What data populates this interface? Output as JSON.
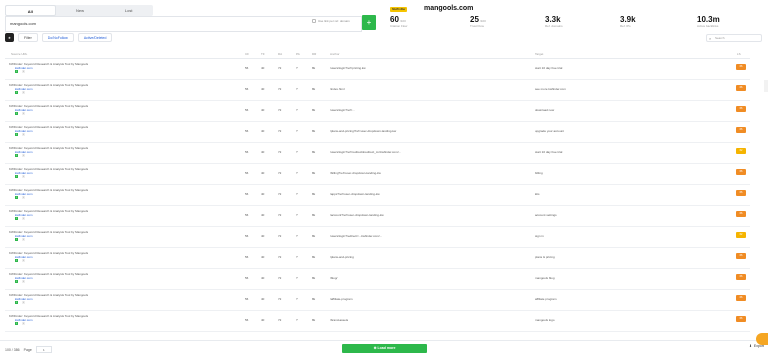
{
  "tabs": [
    "All",
    "New",
    "Lost"
  ],
  "search": {
    "value": "mangools.com",
    "include_label": "Use link per ref. domain"
  },
  "brand": {
    "badge": "SiteProfiler",
    "domain": "mangools.com"
  },
  "stats": [
    {
      "num": "60",
      "suffix": "/100",
      "label": "Citation Flow"
    },
    {
      "num": "25",
      "suffix": "/100",
      "label": "Trust Flow"
    },
    {
      "num": "3.3k",
      "suffix": "",
      "label": "Ref. domains"
    },
    {
      "num": "3.9k",
      "suffix": "",
      "label": "Ref. IPs"
    },
    {
      "num": "10.3m",
      "suffix": "",
      "label": "Active backlinks"
    }
  ],
  "toolbar": {
    "filter_label": "Filter",
    "dofollow_label": "Do/NoFollow",
    "active_label": "Active/Deleted",
    "search_placeholder": "Search"
  },
  "columns": [
    "Source URL",
    "CF",
    "TF",
    "DA",
    "PA",
    "DR",
    "Anchor",
    "Target",
    "Anchor",
    "LS"
  ],
  "rows": [
    {
      "title": "KWFinder: Keyword Research & Analysis Tool by Mangools",
      "url": "kwfinder.com",
      "cf": "56",
      "tf": "40",
      "da": "72",
      "pa": "?",
      "dr": "8k",
      "anchor": "/users/login?ref=pricing.kw",
      "target": "start 10 day free trial",
      "score": "66",
      "color": "#f08c24"
    },
    {
      "title": "KWFinder: Keyword Research & Analysis Tool by Mangools",
      "url": "kwfinder.com",
      "cf": "56",
      "tf": "40",
      "da": "72",
      "pa": "?",
      "dr": "8k",
      "anchor": "/index.html",
      "target": "see more kwfinder.com",
      "score": "66",
      "color": "#f08c24"
    },
    {
      "title": "KWFinder: Keyword Research & Analysis Tool by Mangools",
      "url": "kwfinder.com",
      "cf": "56",
      "tf": "40",
      "da": "72",
      "pa": "?",
      "dr": "8k",
      "anchor": "/users/login?ref=...",
      "target": "download now",
      "score": "66",
      "color": "#f08c24"
    },
    {
      "title": "KWFinder: Keyword Research & Analysis Tool by Mangools",
      "url": "kwfinder.com",
      "cf": "56",
      "tf": "40",
      "da": "72",
      "pa": "?",
      "dr": "8k",
      "anchor": "/plans-and-pricing?ref=user-dropdown-landing-kw",
      "target": "upgrade your account",
      "score": "66",
      "color": "#f08c24"
    },
    {
      "title": "KWFinder: Keyword Research & Analysis Tool by Mangools",
      "url": "kwfinder.com",
      "cf": "56",
      "tf": "40",
      "da": "72",
      "pa": "?",
      "dr": "8k",
      "anchor": "/users/login?ref=redirect&redirect_to=kwfinder.com/...",
      "target": "start 10 day free trial",
      "score": "62",
      "color": "#f5b400"
    },
    {
      "title": "KWFinder: Keyword Research & Analysis Tool by Mangools",
      "url": "kwfinder.com",
      "cf": "56",
      "tf": "40",
      "da": "72",
      "pa": "?",
      "dr": "8k",
      "anchor": "/billing?ref=user-dropdown-landing-kw",
      "target": "billing",
      "score": "66",
      "color": "#f08c24"
    },
    {
      "title": "KWFinder: Keyword Research & Analysis Tool by Mangools",
      "url": "kwfinder.com",
      "cf": "56",
      "tf": "40",
      "da": "72",
      "pa": "?",
      "dr": "8k",
      "anchor": "/apps?ref=user-dropdown-landing-kw",
      "target": "kits",
      "score": "66",
      "color": "#f08c24"
    },
    {
      "title": "KWFinder: Keyword Research & Analysis Tool by Mangools",
      "url": "kwfinder.com",
      "cf": "56",
      "tf": "40",
      "da": "72",
      "pa": "?",
      "dr": "8k",
      "anchor": "/account?ref=user-dropdown-landing-kw",
      "target": "account settings",
      "score": "66",
      "color": "#f08c24"
    },
    {
      "title": "KWFinder: Keyword Research & Analysis Tool by Mangools",
      "url": "kwfinder.com",
      "cf": "56",
      "tf": "40",
      "da": "72",
      "pa": "?",
      "dr": "8k",
      "anchor": "/users/login?redirect=...kwfinder.com/...",
      "target": "sign in",
      "score": "62",
      "color": "#f5b400"
    },
    {
      "title": "KWFinder: Keyword Research & Analysis Tool by Mangools",
      "url": "kwfinder.com",
      "cf": "56",
      "tf": "40",
      "da": "72",
      "pa": "?",
      "dr": "8k",
      "anchor": "/plans-and-pricing",
      "target": "plans & pricing",
      "score": "66",
      "color": "#f08c24"
    },
    {
      "title": "KWFinder: Keyword Research & Analysis Tool by Mangools",
      "url": "kwfinder.com",
      "cf": "56",
      "tf": "40",
      "da": "72",
      "pa": "?",
      "dr": "8k",
      "anchor": "/blog/",
      "target": "mangools blog",
      "score": "66",
      "color": "#f08c24"
    },
    {
      "title": "KWFinder: Keyword Research & Analysis Tool by Mangools",
      "url": "kwfinder.com",
      "cf": "56",
      "tf": "40",
      "da": "72",
      "pa": "?",
      "dr": "8k",
      "anchor": "/affiliate-program",
      "target": "affiliate program",
      "score": "66",
      "color": "#f08c24"
    },
    {
      "title": "KWFinder: Keyword Research & Analysis Tool by Mangools",
      "url": "kwfinder.com",
      "cf": "56",
      "tf": "40",
      "da": "72",
      "pa": "?",
      "dr": "8k",
      "anchor": "/brand-assets",
      "target": "mangools logo",
      "score": "66",
      "color": "#f08c24"
    }
  ],
  "footer": {
    "count": "100 / 386",
    "page_label": "Page",
    "page_value": "1",
    "load_more": "Load more",
    "export": "Export"
  }
}
